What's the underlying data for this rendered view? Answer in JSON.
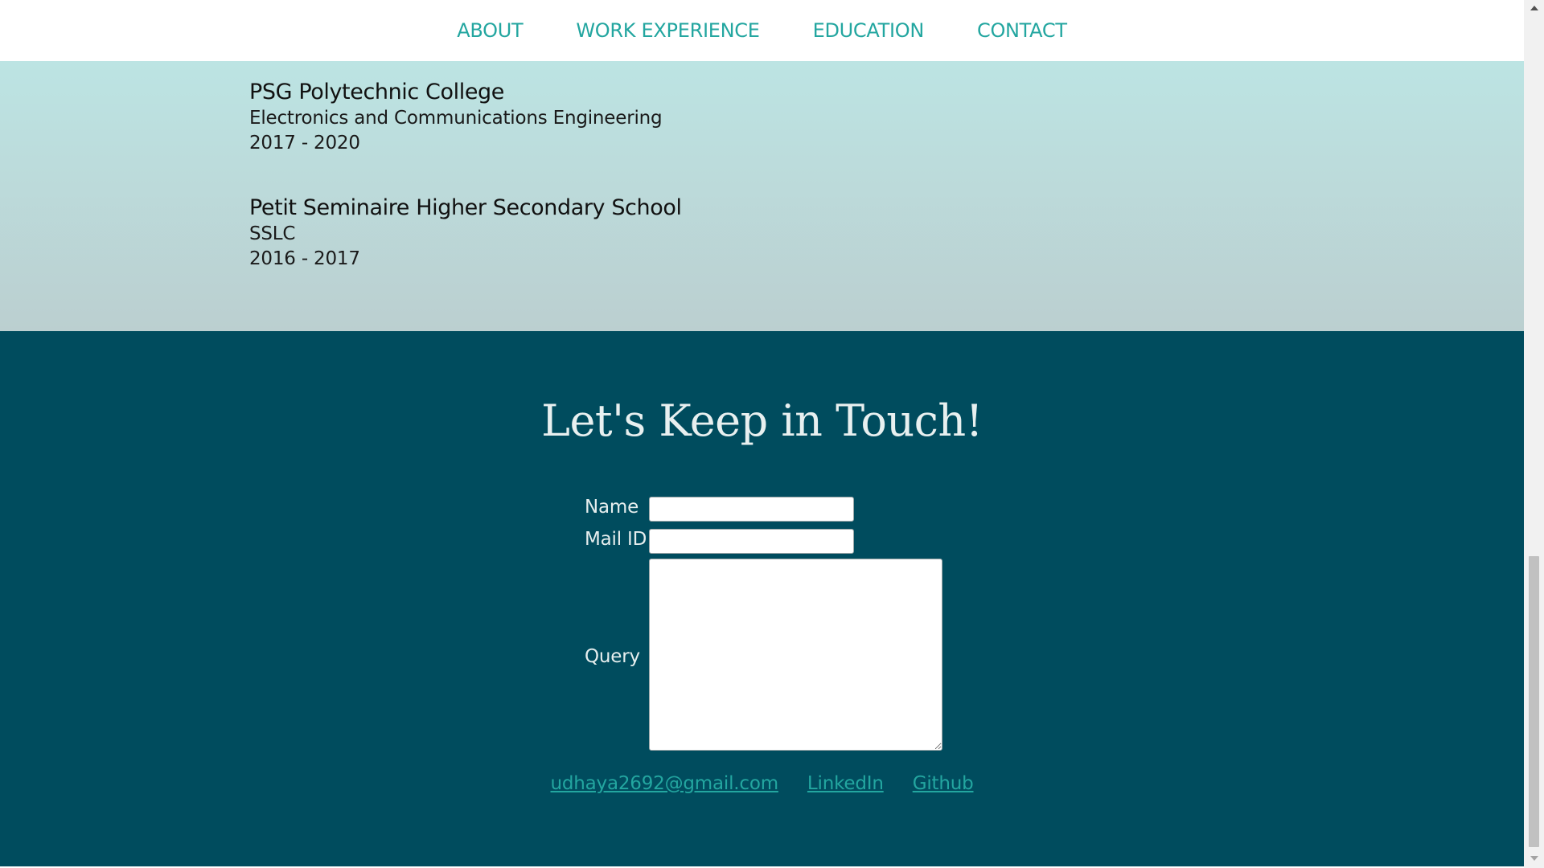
{
  "nav": {
    "items": [
      {
        "label": "ABOUT"
      },
      {
        "label": "WORK EXPERIENCE"
      },
      {
        "label": "EDUCATION"
      },
      {
        "label": "CONTACT"
      }
    ]
  },
  "education": {
    "entries": [
      {
        "school": "PSG Polytechnic College",
        "program": "Electronics and Communications Engineering",
        "years": "2017 - 2020"
      },
      {
        "school": "Petit Seminaire Higher Secondary School",
        "program": "SSLC",
        "years": "2016 - 2017"
      }
    ]
  },
  "contact": {
    "title": "Let's Keep in Touch!",
    "form": {
      "name_label": "Name",
      "name_value": "",
      "mail_label": "Mail ID",
      "mail_value": "",
      "query_label": "Query",
      "query_value": ""
    },
    "links": [
      {
        "label": "udhaya2692@gmail.com"
      },
      {
        "label": "LinkedIn"
      },
      {
        "label": "Github"
      }
    ]
  },
  "colors": {
    "accent": "#23a6a0",
    "contact_bg": "#004c5e",
    "edu_bg_top": "#bce4e3",
    "edu_bg_bottom": "#bbcfd0"
  },
  "icons": {
    "scroll_up": "triangle-up-icon",
    "scroll_down": "triangle-down-icon"
  }
}
